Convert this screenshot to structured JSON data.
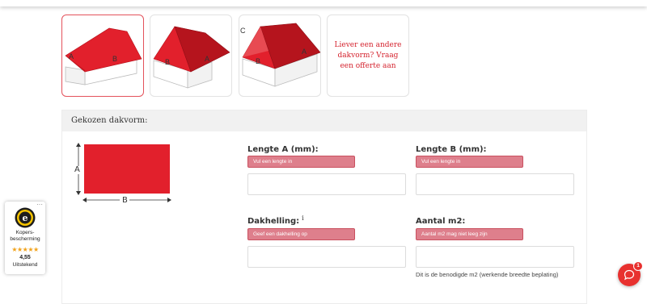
{
  "roof_options": [
    {
      "name": "zadeldak",
      "labels": [
        "A",
        "B"
      ],
      "selected": true
    },
    {
      "name": "zadeldak-zijaanzicht",
      "labels": [
        "B",
        "A"
      ],
      "selected": false
    },
    {
      "name": "schilddak",
      "labels": [
        "C",
        "B",
        "A"
      ],
      "selected": false
    }
  ],
  "other_option": {
    "text": "Liever een andere dakvorm? Vraag een offerte aan"
  },
  "panel": {
    "title": "Gekozen dakvorm:"
  },
  "diagram": {
    "label_a": "A",
    "label_b": "B"
  },
  "fields": {
    "length_a": {
      "label": "Lengte A (mm):",
      "error": "Vul een lengte in",
      "value": ""
    },
    "length_b": {
      "label": "Lengte B (mm):",
      "error": "Vul een lengte in",
      "value": ""
    },
    "slope": {
      "label": "Dakhelling:",
      "info": "i",
      "error": "Geef een dakhelling op",
      "value": ""
    },
    "area": {
      "label": "Aantal m2:",
      "error": "Aantal m2 mag niet leeg zijn",
      "value": "",
      "helper": "Dit is de benodigde m2 (werkende breedte beplating)"
    }
  },
  "trust_badge": {
    "label_line1": "Kopers-",
    "label_line2": "bescherming",
    "stars": "★★★★★",
    "score": "4,55",
    "rating_word": "Uitstekend",
    "menu": "···"
  },
  "chat": {
    "badge_count": "1"
  },
  "colors": {
    "brand_red": "#e2202c",
    "error_badge": "#de7f8c",
    "star": "#f1a21a"
  }
}
